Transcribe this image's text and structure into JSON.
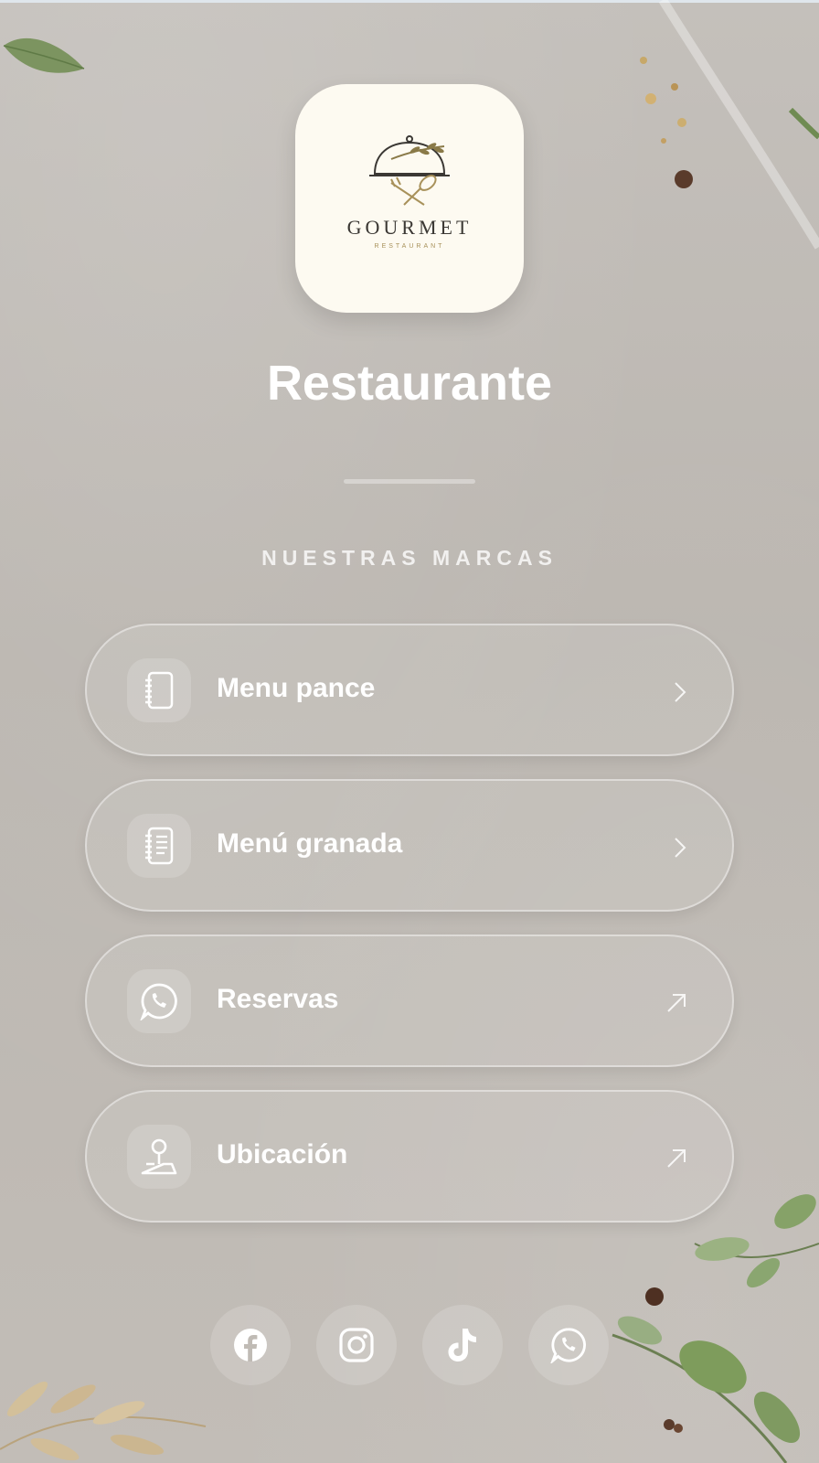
{
  "logo": {
    "brand": "GOURMET",
    "subtitle": "RESTAURANT"
  },
  "header": {
    "title": "Restaurante"
  },
  "section": {
    "label": "NUESTRAS MARCAS"
  },
  "links": [
    {
      "label": "Menu pance",
      "icon": "notebook-icon",
      "arrow": "chevron-right-icon"
    },
    {
      "label": "Menú granada",
      "icon": "menu-notebook-icon",
      "arrow": "chevron-right-icon"
    },
    {
      "label": "Reservas",
      "icon": "whatsapp-icon",
      "arrow": "arrow-up-right-icon"
    },
    {
      "label": "Ubicación",
      "icon": "map-pin-icon",
      "arrow": "arrow-up-right-icon"
    }
  ],
  "social": [
    {
      "icon": "facebook-icon"
    },
    {
      "icon": "instagram-icon"
    },
    {
      "icon": "tiktok-icon"
    },
    {
      "icon": "whatsapp-icon"
    }
  ],
  "colors": {
    "background": "#bdb8b2",
    "logo_card": "#fdfaf1",
    "logo_gold": "#a8915a",
    "text": "#ffffff"
  }
}
